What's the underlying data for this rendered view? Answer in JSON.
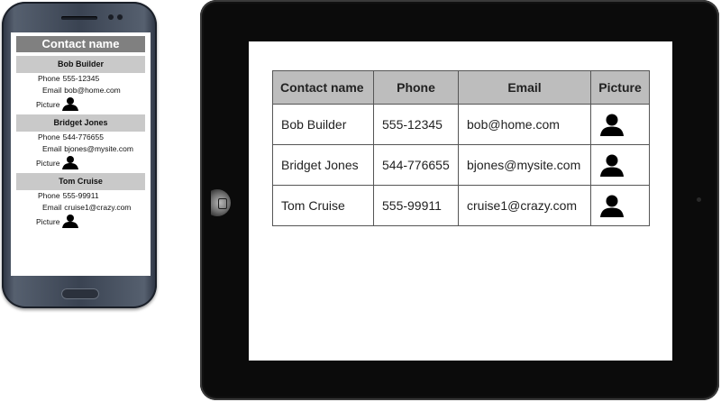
{
  "mobile": {
    "header": "Contact name",
    "phone_label": "Phone",
    "email_label": "Email",
    "picture_label": "Picture"
  },
  "table": {
    "columns": [
      "Contact name",
      "Phone",
      "Email",
      "Picture"
    ]
  },
  "contacts": [
    {
      "name": "Bob Builder",
      "phone": "555-12345",
      "email": "bob@home.com",
      "picture": "person-silhouette-icon"
    },
    {
      "name": "Bridget Jones",
      "phone": "544-776655",
      "email": "bjones@mysite.com",
      "picture": "person-silhouette-icon"
    },
    {
      "name": "Tom Cruise",
      "phone": "555-99911",
      "email": "cruise1@crazy.com",
      "picture": "person-silhouette-icon"
    }
  ],
  "colors": {
    "header_gray": "#808080",
    "name_bar_gray": "#c9c9c9",
    "table_header_gray": "#bdbdbd",
    "tablet_bezel": "#0b0b0b"
  }
}
